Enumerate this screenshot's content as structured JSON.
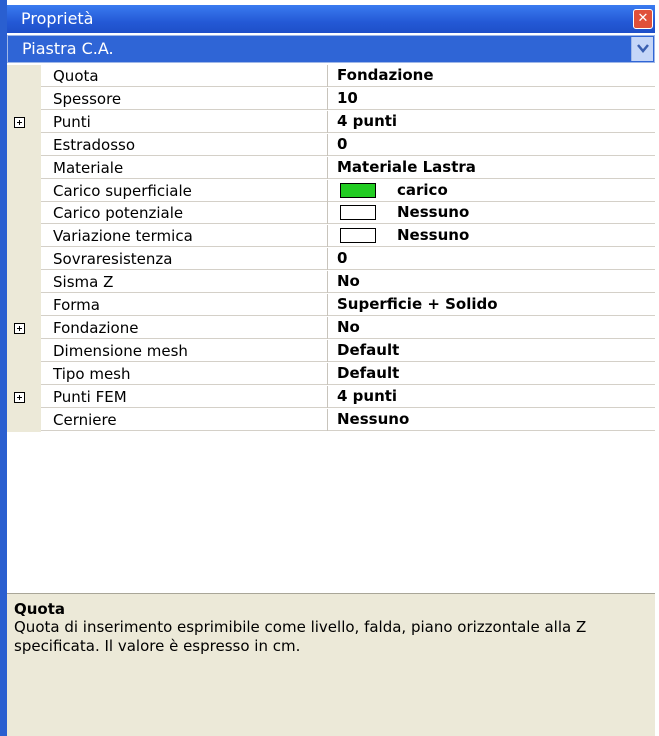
{
  "window": {
    "title": "Proprietà",
    "close_icon": "close-icon"
  },
  "selector": {
    "value": "Piastra C.A.",
    "dropdown_icon": "chevron-down-icon"
  },
  "properties": [
    {
      "name": "Quota",
      "value": "Fondazione",
      "expandable": false
    },
    {
      "name": "Spessore",
      "value": "10",
      "expandable": false
    },
    {
      "name": "Punti",
      "value": "4 punti",
      "expandable": true
    },
    {
      "name": "Estradosso",
      "value": "0",
      "expandable": false
    },
    {
      "name": "Materiale",
      "value": "Materiale Lastra",
      "expandable": false
    },
    {
      "name": "Carico superficiale",
      "value": "carico",
      "swatch": "#22cc22",
      "expandable": false
    },
    {
      "name": "Carico potenziale",
      "value": "Nessuno",
      "swatch": "#ffffff",
      "expandable": false
    },
    {
      "name": "Variazione termica",
      "value": "Nessuno",
      "swatch": "#ffffff",
      "expandable": false
    },
    {
      "name": "Sovraresistenza",
      "value": "0",
      "expandable": false
    },
    {
      "name": "Sisma Z",
      "value": "No",
      "expandable": false
    },
    {
      "name": "Forma",
      "value": "Superficie + Solido",
      "expandable": false
    },
    {
      "name": "Fondazione",
      "value": "No",
      "expandable": true
    },
    {
      "name": "Dimensione mesh",
      "value": "Default",
      "expandable": false
    },
    {
      "name": "Tipo mesh",
      "value": "Default",
      "expandable": false
    },
    {
      "name": "Punti FEM",
      "value": "4 punti",
      "expandable": true
    },
    {
      "name": "Cerniere",
      "value": "Nessuno",
      "expandable": false
    }
  ],
  "description": {
    "title": "Quota",
    "text": "Quota di inserimento esprimibile come livello, falda, piano orizzontale alla Z specificata. Il valore è espresso in cm."
  }
}
